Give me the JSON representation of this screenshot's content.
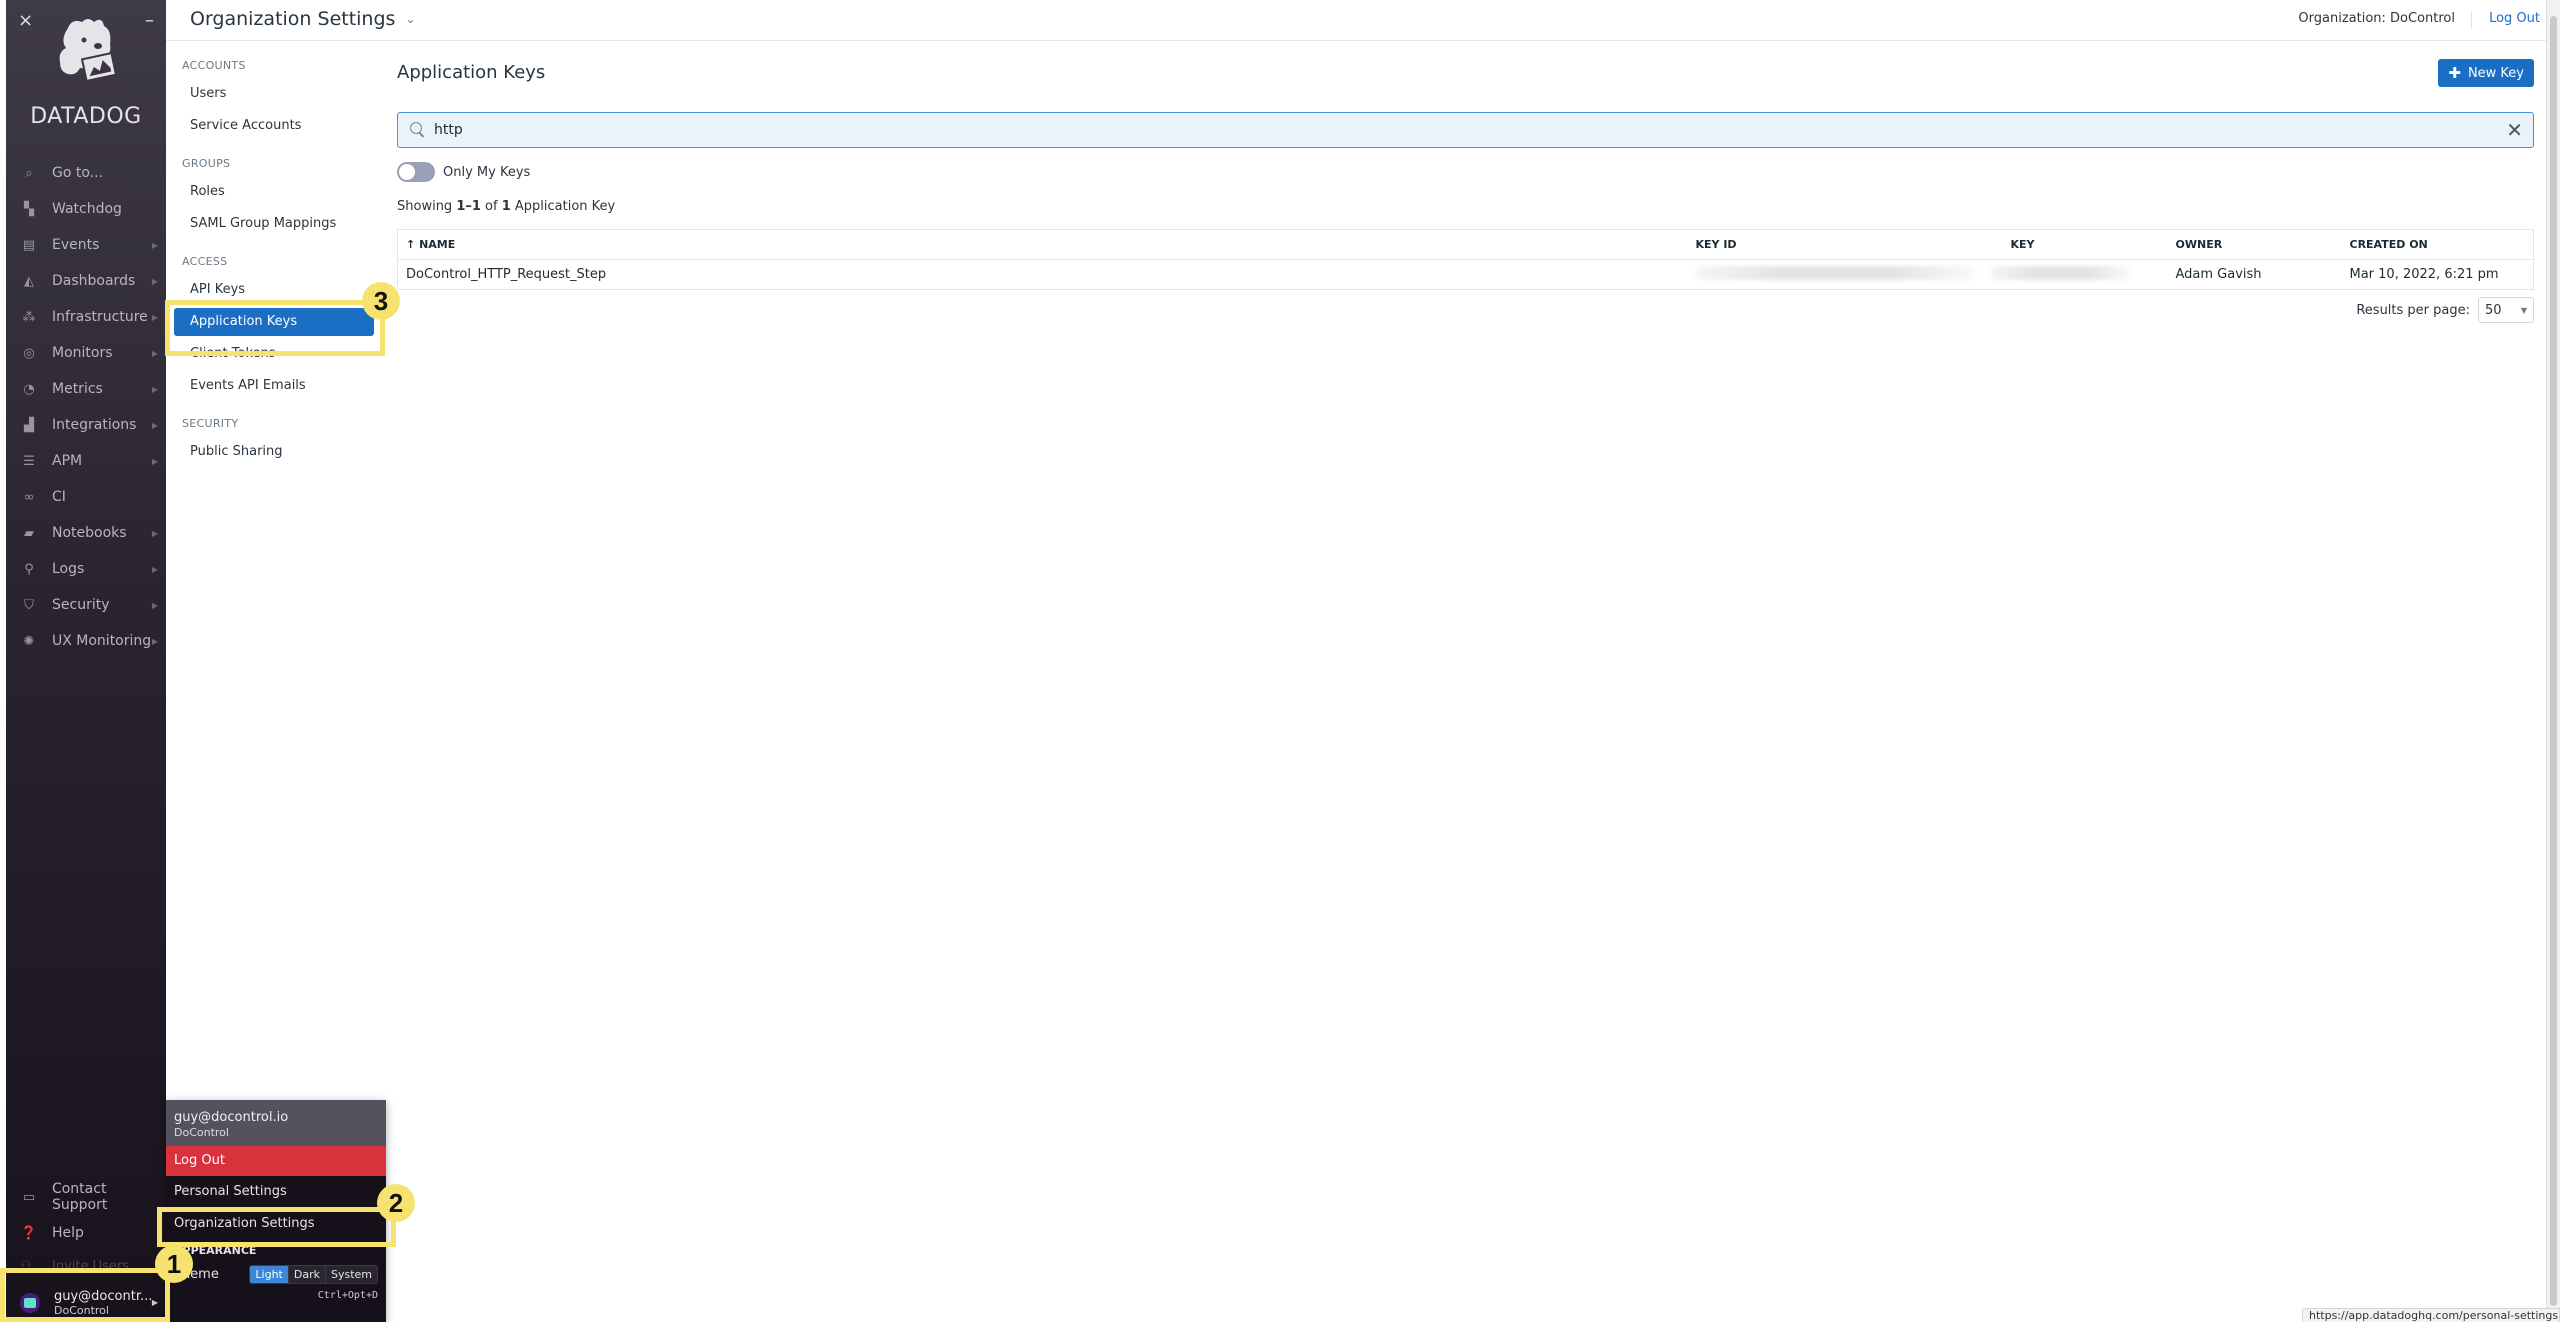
{
  "nav": {
    "close_icon": "×",
    "minimize_icon": "–",
    "logo_text": "DATADOG",
    "items": [
      {
        "label": "Go to...",
        "icon": "search-icon",
        "has_submenu": false
      },
      {
        "label": "Watchdog",
        "icon": "binoculars-icon",
        "has_submenu": false
      },
      {
        "label": "Events",
        "icon": "events-icon",
        "has_submenu": true
      },
      {
        "label": "Dashboards",
        "icon": "dashboards-icon",
        "has_submenu": true
      },
      {
        "label": "Infrastructure",
        "icon": "infrastructure-icon",
        "has_submenu": true
      },
      {
        "label": "Monitors",
        "icon": "monitors-icon",
        "has_submenu": true
      },
      {
        "label": "Metrics",
        "icon": "metrics-icon",
        "has_submenu": true
      },
      {
        "label": "Integrations",
        "icon": "puzzle-icon",
        "has_submenu": true
      },
      {
        "label": "APM",
        "icon": "apm-icon",
        "has_submenu": true
      },
      {
        "label": "CI",
        "icon": "ci-icon",
        "has_submenu": false
      },
      {
        "label": "Notebooks",
        "icon": "notebook-icon",
        "has_submenu": true
      },
      {
        "label": "Logs",
        "icon": "logs-icon",
        "has_submenu": true
      },
      {
        "label": "Security",
        "icon": "shield-icon",
        "has_submenu": true
      },
      {
        "label": "UX Monitoring",
        "icon": "ux-monitoring-icon",
        "has_submenu": true
      }
    ],
    "bottom": [
      {
        "label": "Contact Support",
        "icon": "chat-icon"
      },
      {
        "label": "Help",
        "icon": "help-icon"
      }
    ],
    "invite_label": "Invite Users",
    "user": {
      "name": "guy@docontr...",
      "org": "DoControl"
    }
  },
  "header": {
    "title": "Organization Settings",
    "organization": "Organization: DoControl",
    "logout": "Log Out"
  },
  "subnav": {
    "sections": [
      {
        "heading": "ACCOUNTS",
        "items": [
          "Users",
          "Service Accounts"
        ]
      },
      {
        "heading": "GROUPS",
        "items": [
          "Roles",
          "SAML Group Mappings"
        ]
      },
      {
        "heading": "ACCESS",
        "items": [
          "API Keys",
          "Application Keys",
          "Client Tokens",
          "Events API Emails"
        ]
      },
      {
        "heading": "SECURITY",
        "items": [
          "Public Sharing"
        ]
      }
    ],
    "active": "Application Keys"
  },
  "main": {
    "title": "Application Keys",
    "new_key_label": "New Key",
    "search": {
      "value": "http",
      "placeholder": ""
    },
    "toggle": {
      "label": "Only My Keys",
      "on": false
    },
    "showing": {
      "prefix": "Showing ",
      "range": "1–1",
      "mid": " of ",
      "total": "1",
      "suffix": " Application Key"
    },
    "table": {
      "columns": [
        "NAME",
        "KEY ID",
        "KEY",
        "OWNER",
        "CREATED ON"
      ],
      "sort_indicator": "↑",
      "rows": [
        {
          "name": "DoControl_HTTP_Request_Step",
          "key_id": "[redacted]",
          "key": "[redacted]",
          "owner": "Adam Gavish",
          "created_on": "Mar 10, 2022, 6:21 pm"
        }
      ]
    },
    "results_per_page": {
      "label": "Results per page:",
      "value": "50"
    }
  },
  "user_menu": {
    "email": "guy@docontrol.io",
    "org": "DoControl",
    "logout": "Log Out",
    "personal_settings": "Personal Settings",
    "organization_settings": "Organization Settings",
    "appearance_heading": "APPEARANCE",
    "theme_label": "Theme",
    "theme_options": [
      "Light",
      "Dark",
      "System"
    ],
    "theme_selected": "Light",
    "shortcut": "Ctrl+Opt+D"
  },
  "annotations": [
    "1",
    "2",
    "3"
  ],
  "status_url": "https://app.datadoghq.com/personal-settings"
}
